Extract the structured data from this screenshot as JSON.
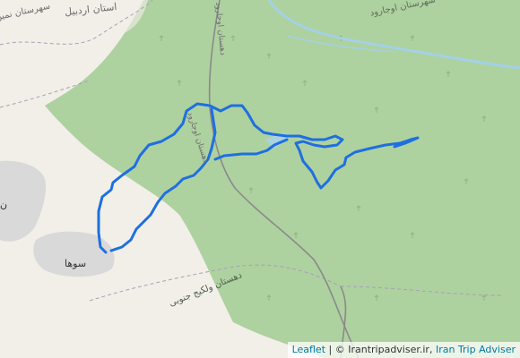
{
  "map": {
    "labels": {
      "province": "استان اردبیل",
      "county_top": "سهرستان نمین",
      "county_right": "سهرستان اوجارود",
      "village": "سوها",
      "partial_place": "ن",
      "road_1": "دهستان اوجارود",
      "road_2": "دهستان اوجارود",
      "road_3": "دهستان ولکیج جنوبی"
    },
    "colors": {
      "forest": "#aed1a0",
      "land": "#f2efe9",
      "settlement": "#d9d9d9",
      "track": "#1e6fe0",
      "water": "#aad3df",
      "river": "#a3d1e5"
    }
  },
  "attribution": {
    "leaflet": "Leaflet",
    "separator": "| ©",
    "site": "Irantripadviser.ir",
    "comma": ",",
    "brand": "Iran Trip Adviser"
  }
}
